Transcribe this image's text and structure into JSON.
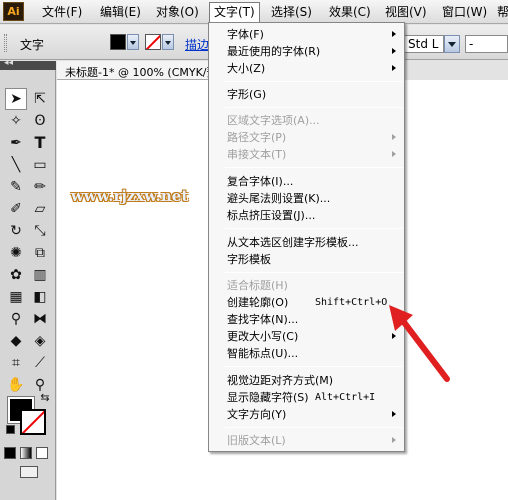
{
  "menubar": {
    "logo": "Ai",
    "items": [
      "文件(F)",
      "编辑(E)",
      "对象(O)",
      "文字(T)",
      "选择(S)",
      "效果(C)",
      "视图(V)",
      "窗口(W)",
      "帮"
    ]
  },
  "control_bar": {
    "tool_label": "文字",
    "stroke_link": "描边",
    "font_style_value": "Std L",
    "font_size_value": "-"
  },
  "document": {
    "tab_title": "未标题-1* @ 100% (CMYK/预",
    "watermark": "www.rjzxw.net"
  },
  "type_menu": {
    "items": [
      {
        "label": "字体(F)",
        "submenu": true,
        "enabled": true
      },
      {
        "label": "最近使用的字体(R)",
        "submenu": true,
        "enabled": true
      },
      {
        "label": "大小(Z)",
        "submenu": true,
        "enabled": true
      },
      {
        "label": "字形(G)",
        "enabled": true
      },
      {
        "label": "区域文字选项(A)...",
        "enabled": false
      },
      {
        "label": "路径文字(P)",
        "submenu": true,
        "enabled": false
      },
      {
        "label": "串接文本(T)",
        "submenu": true,
        "enabled": false
      },
      {
        "label": "复合字体(I)...",
        "enabled": true
      },
      {
        "label": "避头尾法则设置(K)...",
        "enabled": true
      },
      {
        "label": "标点挤压设置(J)...",
        "enabled": true
      },
      {
        "label": "从文本选区创建字形模板...",
        "enabled": true
      },
      {
        "label": "字形模板",
        "enabled": true
      },
      {
        "label": "适合标题(H)",
        "enabled": false
      },
      {
        "label": "创建轮廓(O)",
        "shortcut": "Shift+Ctrl+O",
        "enabled": true
      },
      {
        "label": "查找字体(N)...",
        "enabled": true
      },
      {
        "label": "更改大小写(C)",
        "submenu": true,
        "enabled": true
      },
      {
        "label": "智能标点(U)...",
        "enabled": true
      },
      {
        "label": "视觉边距对齐方式(M)",
        "enabled": true
      },
      {
        "label": "显示隐藏字符(S)",
        "shortcut": "Alt+Ctrl+I",
        "enabled": true
      },
      {
        "label": "文字方向(Y)",
        "submenu": true,
        "enabled": true
      },
      {
        "label": "旧版文本(L)",
        "submenu": true,
        "enabled": false
      }
    ]
  },
  "colors": {
    "annotation_arrow": "#e02020",
    "disabled_text": "#a0a0a0",
    "link_blue": "#0033cc"
  }
}
